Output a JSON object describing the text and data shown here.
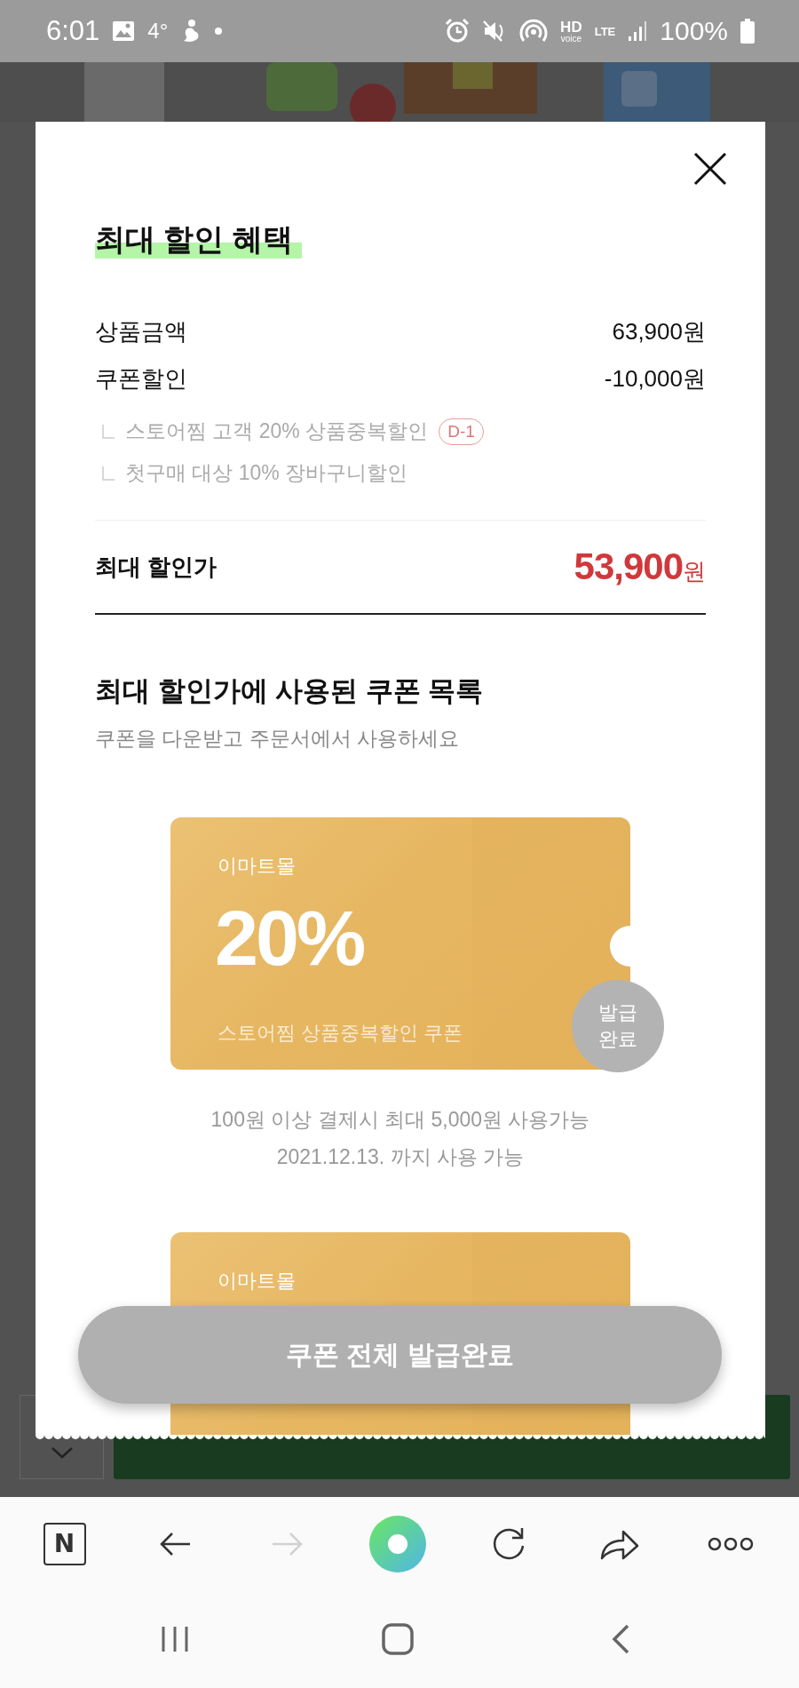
{
  "status_bar": {
    "time": "6:01",
    "temperature": "4°",
    "network_labels": [
      "HD",
      "voice",
      "LTE"
    ],
    "battery": "100%"
  },
  "modal": {
    "title": "최대 할인 혜택",
    "summary_rows": [
      {
        "label": "상품금액",
        "value": "63,900원"
      },
      {
        "label": "쿠폰할인",
        "value": "-10,000원"
      }
    ],
    "applied_coupons": [
      {
        "name": "스토어찜 고객 20% 상품중복할인",
        "badge": "D-1"
      },
      {
        "name": "첫구매 대상 10% 장바구니할인"
      }
    ],
    "total": {
      "label": "최대 할인가",
      "amount": "53,900",
      "unit": "원"
    },
    "coupon_section": {
      "title": "최대 할인가에 사용된 쿠폰 목록",
      "subtitle": "쿠폰을 다운받고 주문서에서 사용하세요"
    },
    "coupons": [
      {
        "store": "이마트몰",
        "discount": "20%",
        "name": "스토어찜 상품중복할인 쿠폰",
        "status": "발급 완료",
        "conditions": [
          "100원 이상 결제시 최대 5,000원 사용가능",
          "2021.12.13. 까지 사용 가능"
        ]
      },
      {
        "store": "이마트몰"
      }
    ],
    "action_button": {
      "label": "쿠폰 전체 발급완료",
      "disabled": true
    }
  },
  "browser_toolbar": [
    {
      "kind": "home",
      "label": "N",
      "disabled": false
    },
    {
      "kind": "back",
      "disabled": false
    },
    {
      "kind": "forward",
      "disabled": true
    },
    {
      "kind": "assistant",
      "disabled": false
    },
    {
      "kind": "reload",
      "disabled": false
    },
    {
      "kind": "share",
      "disabled": false
    },
    {
      "kind": "more",
      "disabled": false
    }
  ]
}
